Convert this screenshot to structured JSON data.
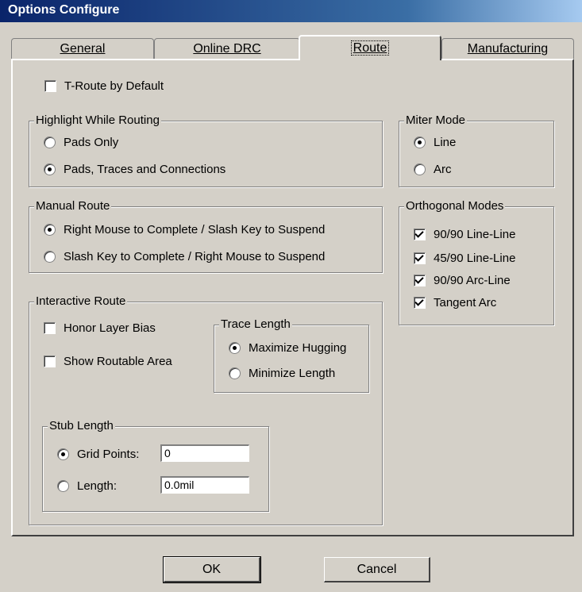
{
  "window": {
    "title": "Options Configure"
  },
  "tabs": [
    {
      "label": "General"
    },
    {
      "label": "Online DRC"
    },
    {
      "label": "Route",
      "active": true
    },
    {
      "label": "Manufacturing"
    }
  ],
  "t_route": {
    "label": "T-Route by Default",
    "checked": false
  },
  "highlight": {
    "title": "Highlight While Routing",
    "options": [
      {
        "label": "Pads Only",
        "selected": false
      },
      {
        "label": "Pads, Traces and Connections",
        "selected": true
      }
    ]
  },
  "manual_route": {
    "title": "Manual Route",
    "options": [
      {
        "label": "Right Mouse to Complete / Slash Key to Suspend",
        "selected": true
      },
      {
        "label": "Slash Key to Complete / Right Mouse to Suspend",
        "selected": false
      }
    ]
  },
  "interactive_route": {
    "title": "Interactive Route",
    "honor_layer_bias": {
      "label": "Honor Layer Bias",
      "checked": false
    },
    "show_routable_area": {
      "label": "Show Routable Area",
      "checked": false
    },
    "trace_length": {
      "title": "Trace Length",
      "options": [
        {
          "label": "Maximize Hugging",
          "selected": true
        },
        {
          "label": "Minimize Length",
          "selected": false
        }
      ]
    },
    "stub_length": {
      "title": "Stub Length",
      "grid_points": {
        "label": "Grid Points:",
        "value": "0",
        "selected": true
      },
      "length": {
        "label": "Length:",
        "value": "0.0mil",
        "selected": false
      }
    }
  },
  "miter_mode": {
    "title": "Miter Mode",
    "options": [
      {
        "label": "Line",
        "selected": true
      },
      {
        "label": "Arc",
        "selected": false
      }
    ]
  },
  "orthogonal_modes": {
    "title": "Orthogonal Modes",
    "options": [
      {
        "label": "90/90  Line-Line",
        "checked": true
      },
      {
        "label": "45/90  Line-Line",
        "checked": true
      },
      {
        "label": "90/90  Arc-Line",
        "checked": true
      },
      {
        "label": "Tangent Arc",
        "checked": true
      }
    ]
  },
  "buttons": {
    "ok": "OK",
    "cancel": "Cancel"
  }
}
